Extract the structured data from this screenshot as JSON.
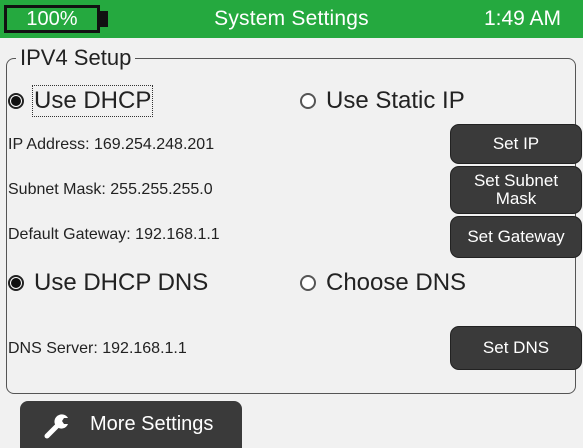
{
  "status_bar": {
    "battery_label": "100%",
    "battery_level_percent": 100,
    "title": "System Settings",
    "time": "1:49 AM",
    "accent_color": "#25a93f"
  },
  "ipv4": {
    "legend": "IPV4 Setup",
    "ip_mode": {
      "selected": "Use DHCP",
      "options": [
        "Use DHCP",
        "Use Static IP"
      ]
    },
    "ip_address": "IP Address: 169.254.248.201",
    "subnet_mask": "Subnet Mask: 255.255.255.0",
    "default_gateway": "Default Gateway: 192.168.1.1",
    "dns_mode": {
      "selected": "Use DHCP DNS",
      "options": [
        "Use DHCP DNS",
        "Choose DNS"
      ]
    },
    "dns_server": "DNS Server: 192.168.1.1"
  },
  "buttons": {
    "set_ip": "Set IP",
    "set_subnet_mask": "Set Subnet Mask",
    "set_gateway": "Set Gateway",
    "set_dns": "Set DNS"
  },
  "footer": {
    "more_settings": "More Settings",
    "more_settings_icon": "wrench-icon"
  }
}
